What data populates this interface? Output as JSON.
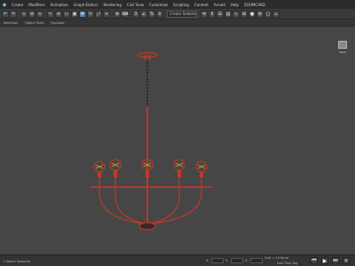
{
  "menu": {
    "items": [
      "Create",
      "Modifiers",
      "Animation",
      "Graph Editors",
      "Rendering",
      "Civil View",
      "Customize",
      "Scripting",
      "Content",
      "Arnold",
      "Help",
      "ZOOMCARD"
    ]
  },
  "toolbar": {
    "selection_set_placeholder": "Create Selection Se"
  },
  "ribbon": {
    "labels": [
      "Selection",
      "Object Paint",
      "Populate"
    ]
  },
  "status": {
    "left_text": "1 Object Selected",
    "coord_x_label": "X:",
    "coord_y_label": "Y:",
    "coord_z_label": "Z:",
    "grid_text": "Grid = 10.0mm",
    "add_time_tag": "Add Time Tag"
  },
  "colors": {
    "wire": "#c0392b",
    "glass": "#d4a017",
    "viewport_bg": "#464646"
  }
}
